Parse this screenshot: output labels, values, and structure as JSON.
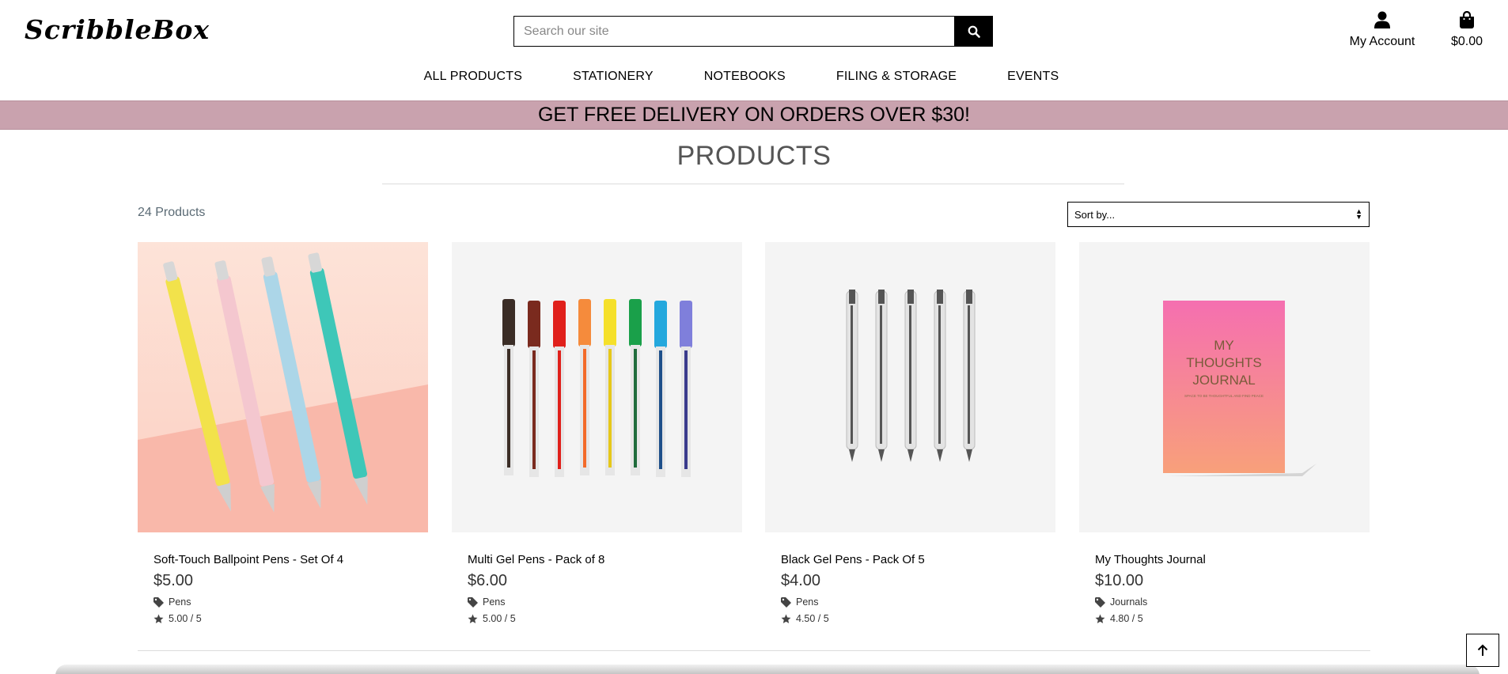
{
  "header": {
    "logo": "ScribbleBox",
    "search_placeholder": "Search our site",
    "account_label": "My Account",
    "bag_total": "$0.00"
  },
  "nav": {
    "items": [
      "ALL PRODUCTS",
      "STATIONERY",
      "NOTEBOOKS",
      "FILING & STORAGE",
      "EVENTS"
    ]
  },
  "banner": "GET FREE DELIVERY ON ORDERS OVER $30!",
  "main": {
    "title": "PRODUCTS",
    "count": "24 Products",
    "sort_selected": "Sort by..."
  },
  "products": [
    {
      "name": "Soft-Touch Ballpoint Pens - Set Of 4",
      "price": "$5.00",
      "category": "Pens",
      "rating": "5.00 / 5"
    },
    {
      "name": "Multi Gel Pens - Pack of 8",
      "price": "$6.00",
      "category": "Pens",
      "rating": "5.00 / 5"
    },
    {
      "name": "Black Gel Pens - Pack Of 5",
      "price": "$4.00",
      "category": "Pens",
      "rating": "4.50 / 5"
    },
    {
      "name": "My Thoughts Journal",
      "price": "$10.00",
      "category": "Journals",
      "rating": "4.80 / 5"
    }
  ],
  "journal_cover": {
    "line1": "MY",
    "line2": "THOUGHTS",
    "line3": "JOURNAL",
    "tagline": "SPACE TO BE THOUGHTFUL AND FIND PEACE"
  },
  "colors": {
    "banner": "#c9a2ae",
    "text": "#000000",
    "muted": "#5b6b75"
  },
  "icons": [
    "search-icon",
    "user-icon",
    "shopping-bag-icon",
    "tag-icon",
    "star-icon",
    "arrow-up-icon",
    "sort-arrows-icon"
  ]
}
